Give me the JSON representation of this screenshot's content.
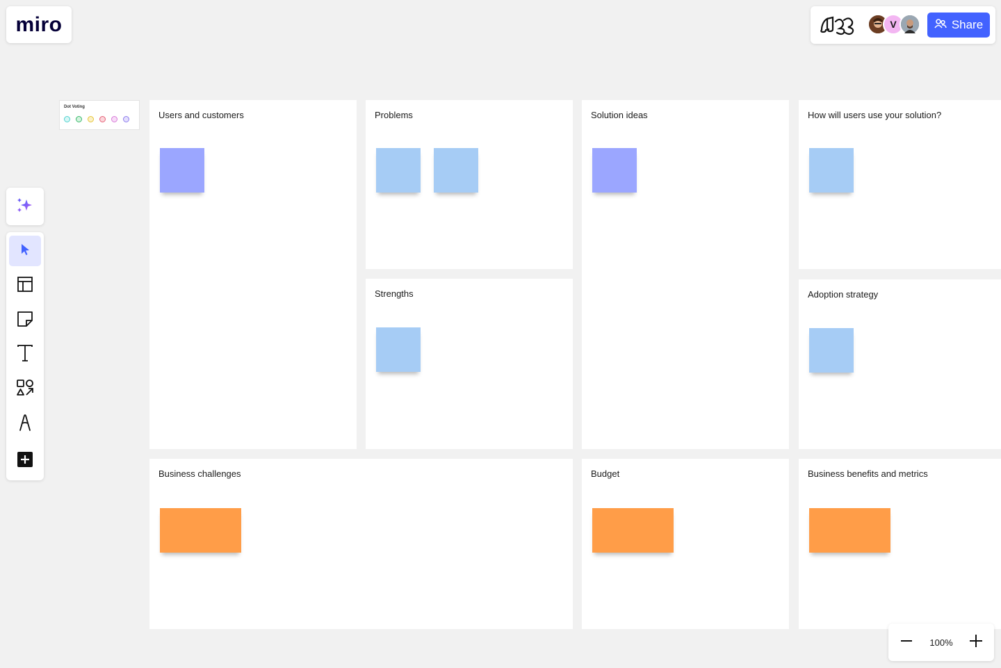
{
  "app": {
    "logo_text": "miro"
  },
  "topbar": {
    "board_icon": "board-sketch-icon",
    "collaborators": [
      {
        "name": "collaborator-1",
        "initial": ""
      },
      {
        "name": "collaborator-2",
        "initial": "V"
      },
      {
        "name": "collaborator-3",
        "initial": ""
      }
    ],
    "share_label": "Share",
    "share_icon": "people-icon",
    "accent_color": "#4262ff"
  },
  "dot_voting": {
    "title": "Dot Voting",
    "dot_colors": [
      "#6ee3e0",
      "#46c97a",
      "#f3d64b",
      "#f07a8a",
      "#e69ae6",
      "#a99bf5"
    ]
  },
  "frames": {
    "users": {
      "title": "Users and customers"
    },
    "problems": {
      "title": "Problems"
    },
    "solutions": {
      "title": "Solution ideas"
    },
    "usage": {
      "title": "How will users use your solution?"
    },
    "strengths": {
      "title": "Strengths"
    },
    "adoption": {
      "title": "Adoption strategy"
    },
    "challenges": {
      "title": "Business challenges"
    },
    "budget": {
      "title": "Budget"
    },
    "benefits": {
      "title": "Business benefits and metrics"
    }
  },
  "sticky_colors": {
    "purple": "#9ba6ff",
    "blue": "#a6ccf5",
    "orange": "#ff9d48"
  },
  "toolbar": {
    "ai_icon": "ai-sparkle-icon",
    "tools": [
      "select-tool",
      "templates-tool",
      "sticky-note-tool",
      "text-tool",
      "shapes-tool",
      "pen-tool",
      "more-apps-tool"
    ]
  },
  "zoom": {
    "value": "100%"
  }
}
